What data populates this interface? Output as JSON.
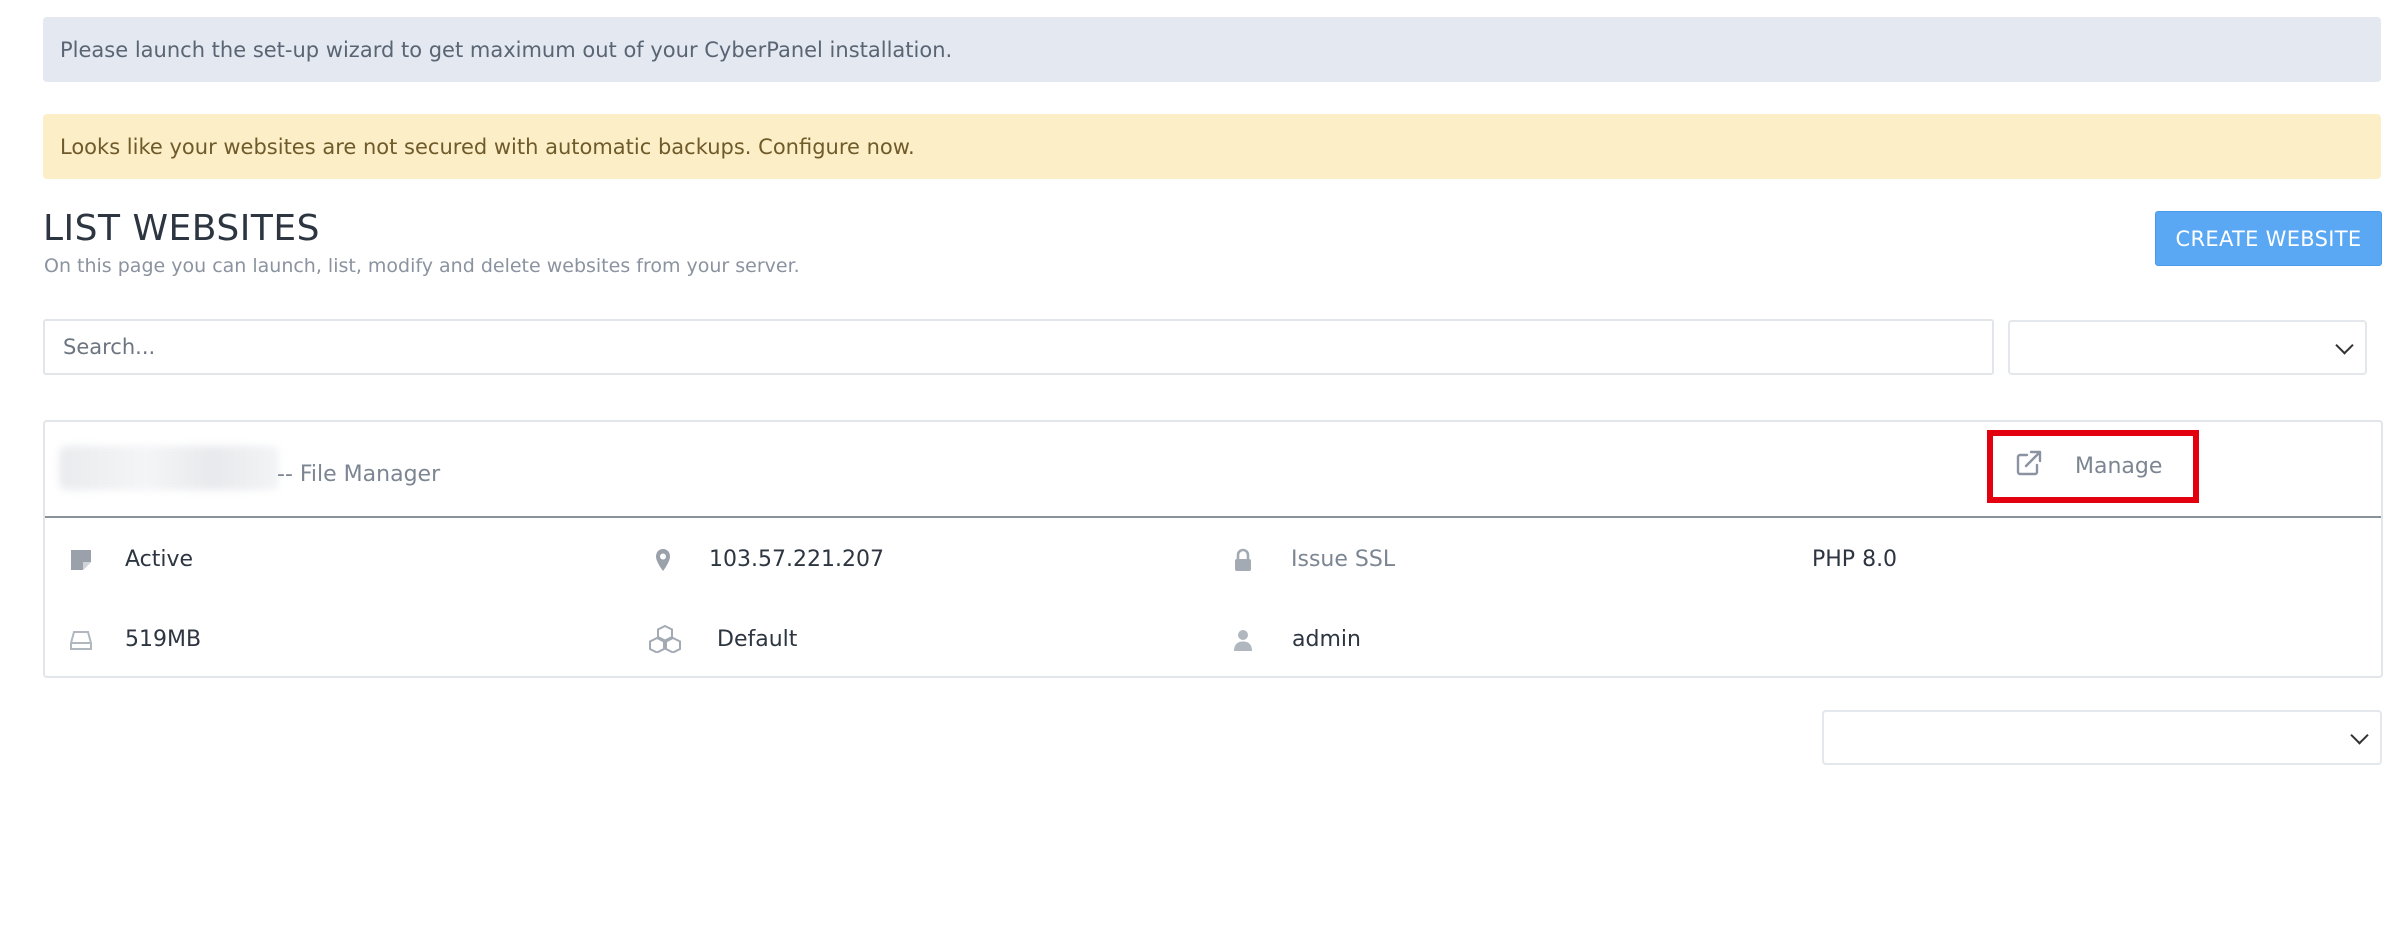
{
  "alerts": {
    "setup": "Please launch the set-up wizard to get maximum out of your CyberPanel installation.",
    "backups": "Looks like your websites are not secured with automatic backups. Configure now."
  },
  "header": {
    "title": "LIST WEBSITES",
    "subtitle": "On this page you can launch, list, modify and delete websites from your server.",
    "create_button": "CREATE WEBSITE"
  },
  "search": {
    "placeholder": "Search..."
  },
  "website": {
    "file_manager_link": "-- File Manager",
    "manage_label": "Manage",
    "status": "Active",
    "ip": "103.57.221.207",
    "ssl": "Issue SSL",
    "php": "PHP 8.0",
    "disk_usage": "519MB",
    "package": "Default",
    "owner": "admin"
  },
  "icons": {
    "status": "note-icon",
    "ip": "map-marker-icon",
    "ssl": "lock-icon",
    "disk": "hdd-icon",
    "package": "cubes-icon",
    "owner": "user-icon",
    "manage": "external-link-icon",
    "select": "chevron-down-icon"
  },
  "colors": {
    "primary_button": "#5aa8f4",
    "info_alert_bg": "#e3e8f1",
    "warning_alert_bg": "#fcefc8",
    "highlight_border": "#e3000f"
  }
}
